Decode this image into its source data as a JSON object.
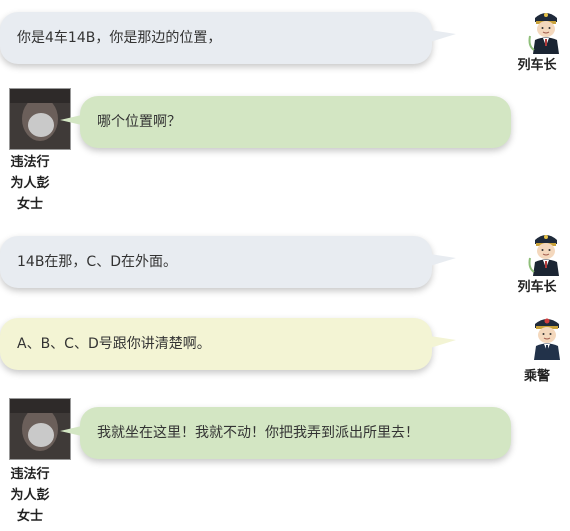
{
  "messages": [
    {
      "text": "你是4车14B，你是那边的位置，",
      "speaker": "列车长"
    },
    {
      "text": "哪个位置啊？",
      "speaker": "违法行为人彭女士"
    },
    {
      "text": "14B在那，C、D在外面。",
      "speaker": "列车长"
    },
    {
      "text": "A、B、C、D号跟你讲清楚啊。",
      "speaker": "乘警"
    },
    {
      "text": "我就坐在这里！我就不动！你把我弄到派出所里去！",
      "speaker": "违法行为人彭女士"
    }
  ],
  "names": {
    "conductor": "列车长",
    "police": "乘警",
    "offender_line1": "违法行",
    "offender_line2": "为人彭",
    "offender_line3": "女士"
  },
  "colors": {
    "gray_bubble": "#e8ecf1",
    "green_bubble": "#d3e6c3",
    "yellow_bubble": "#f3f4d4"
  }
}
